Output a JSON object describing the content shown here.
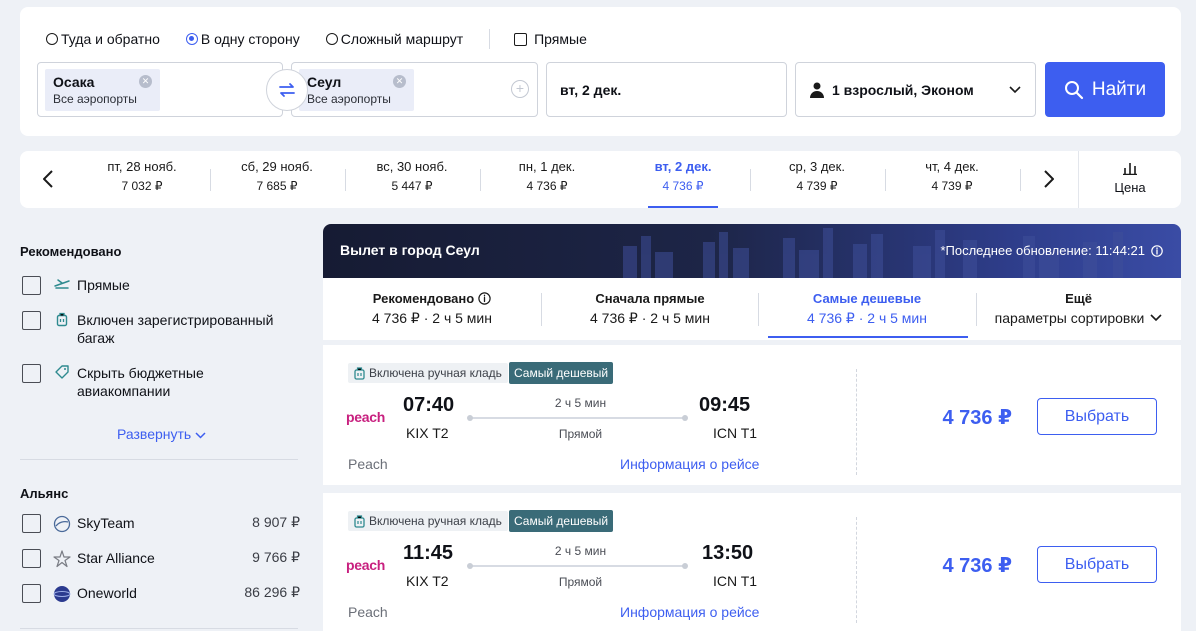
{
  "search": {
    "trip_types": [
      "Туда и обратно",
      "В одну сторону",
      "Сложный маршрут"
    ],
    "direct_label": "Прямые",
    "origin": {
      "city": "Осака",
      "sub": "Все аэропорты"
    },
    "destination": {
      "city": "Сеул",
      "sub": "Все аэропорты"
    },
    "date": "вт, 2 дек.",
    "passengers": "1 взрослый, Эконом",
    "find_label": "Найти"
  },
  "date_strip": {
    "dates": [
      {
        "day": "пт, 28 нояб.",
        "price": "7 032 ₽"
      },
      {
        "day": "сб, 29 нояб.",
        "price": "7 685 ₽"
      },
      {
        "day": "вс, 30 нояб.",
        "price": "5 447 ₽"
      },
      {
        "day": "пн, 1 дек.",
        "price": "4 736 ₽"
      },
      {
        "day": "вт, 2 дек.",
        "price": "4 736 ₽"
      },
      {
        "day": "ср, 3 дек.",
        "price": "4 739 ₽"
      },
      {
        "day": "чт, 4 дек.",
        "price": "4 739 ₽"
      }
    ],
    "price_label": "Цена"
  },
  "sidebar": {
    "recommended_title": "Рекомендовано",
    "recommended": [
      {
        "label": "Прямые",
        "icon": "plane-icon"
      },
      {
        "label": "Включен зарегистрированный багаж",
        "icon": "suitcase-icon"
      },
      {
        "label": "Скрыть бюджетные авиакомпании",
        "icon": "tag-icon"
      }
    ],
    "expand_label": "Развернуть",
    "alliance_title": "Альянс",
    "alliances": [
      {
        "label": "SkyTeam",
        "price": "8 907 ₽"
      },
      {
        "label": "Star Alliance",
        "price": "9 766 ₽"
      },
      {
        "label": "Oneworld",
        "price": "86 296 ₽"
      }
    ]
  },
  "results": {
    "title": "Вылет в город Сеул",
    "updated": "*Последнее обновление: 11:44:21",
    "sort_tabs": [
      {
        "a": "Рекомендовано",
        "b": "4 736 ₽ · 2 ч 5 мин"
      },
      {
        "a": "Сначала прямые",
        "b": "4 736 ₽ · 2 ч 5 мин"
      },
      {
        "a": "Самые дешевые",
        "b": "4 736 ₽ · 2 ч 5 мин"
      },
      {
        "a": "Ещё",
        "b": "параметры сортировки"
      }
    ],
    "flights": [
      {
        "bag_tag": "Включена ручная кладь",
        "cheap_tag": "Самый дешевый",
        "logo": "peach",
        "dep_time": "07:40",
        "dep_apt": "KIX T2",
        "duration": "2 ч 5 мин",
        "stops": "Прямой",
        "arr_time": "09:45",
        "arr_apt": "ICN T1",
        "airline": "Peach",
        "info": "Информация о рейсе",
        "price": "4 736 ₽",
        "select": "Выбрать"
      },
      {
        "bag_tag": "Включена ручная кладь",
        "cheap_tag": "Самый дешевый",
        "logo": "peach",
        "dep_time": "11:45",
        "dep_apt": "KIX T2",
        "duration": "2 ч 5 мин",
        "stops": "Прямой",
        "arr_time": "13:50",
        "arr_apt": "ICN T1",
        "airline": "Peach",
        "info": "Информация о рейсе",
        "price": "4 736 ₽",
        "select": "Выбрать"
      }
    ]
  },
  "colors": {
    "accent": "#3d5ef0",
    "cheap_tag": "#3a6b78",
    "peach_logo": "#c8207f"
  }
}
